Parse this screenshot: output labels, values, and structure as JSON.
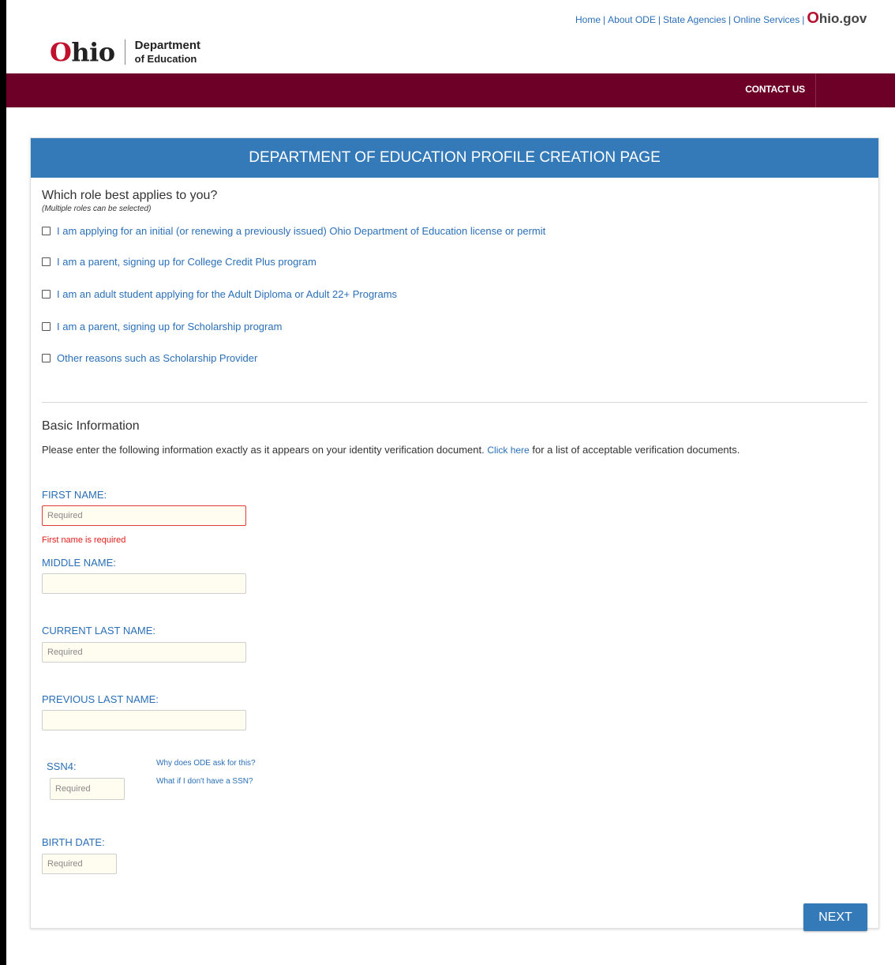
{
  "top_links": {
    "home": "Home",
    "about": "About ODE",
    "agencies": "State Agencies",
    "services": "Online Services",
    "sep": "|",
    "ohio_gov_o": "O",
    "ohio_gov_rest": "hio.gov"
  },
  "logo": {
    "ohio_o": "O",
    "ohio_rest": "hio",
    "dept_line1": "Department",
    "dept_line2": "of Education"
  },
  "nav": {
    "contact": "CONTACT US"
  },
  "page": {
    "header": "DEPARTMENT OF EDUCATION PROFILE CREATION PAGE"
  },
  "roles": {
    "question": "Which role best applies to you?",
    "note": "(Multiple roles can be selected)",
    "options": [
      "I am applying for an initial (or renewing a previously issued) Ohio Department of Education license or permit",
      "I am a parent, signing up for College Credit Plus program",
      "I am an adult student applying for the Adult Diploma or Adult 22+ Programs",
      "I am a parent, signing up for Scholarship program",
      "Other reasons such as Scholarship Provider"
    ]
  },
  "basic": {
    "title": "Basic Information",
    "desc_before": "Please enter the following information exactly as it appears on your identity verification document.",
    "link": "Click here",
    "desc_after": "for a list of acceptable verification documents."
  },
  "fields": {
    "first_name": {
      "label": "FIRST NAME:",
      "placeholder": "Required",
      "error": "First name is required"
    },
    "middle_name": {
      "label": "MIDDLE NAME:",
      "placeholder": ""
    },
    "current_last": {
      "label": "CURRENT LAST NAME:",
      "placeholder": "Required"
    },
    "previous_last": {
      "label": "PREVIOUS LAST NAME:",
      "placeholder": ""
    },
    "ssn4": {
      "label": "SSN4:",
      "placeholder": "Required",
      "help1": "Why does ODE ask for this?",
      "help2": "What if I don't have a SSN?"
    },
    "birth_date": {
      "label": "BIRTH DATE:",
      "placeholder": "Required"
    }
  },
  "buttons": {
    "next": "NEXT"
  }
}
